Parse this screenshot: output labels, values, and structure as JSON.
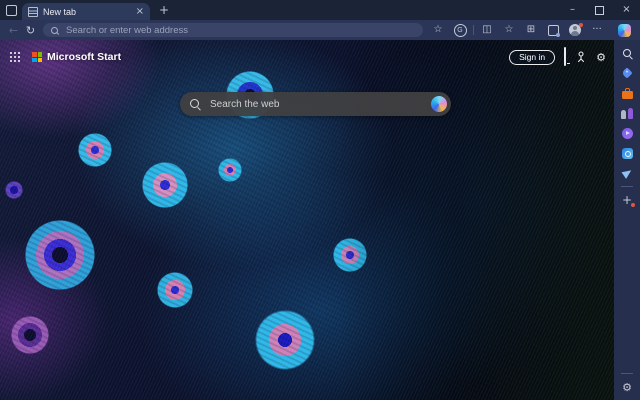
{
  "titlebar": {
    "tab_title": "New tab",
    "close_tab_glyph": "×",
    "new_tab_glyph": "+",
    "minimize_glyph": "–",
    "close_window_glyph": "×"
  },
  "toolbar": {
    "back_glyph": "←",
    "refresh_glyph": "↻",
    "address_placeholder": "Search or enter web address",
    "favorite_star_glyph": "☆",
    "extension_g_label": "G",
    "split_screen_glyph": "◫",
    "favorites_hub_glyph": "☆",
    "collections_glyph": "⊞",
    "more_glyph": "···"
  },
  "page": {
    "brand": "Microsoft Start",
    "sign_in": "Sign in",
    "search_placeholder": "Search the web",
    "settings_glyph": "⚙"
  },
  "sidebar": {
    "plus_glyph": "+",
    "settings_glyph": "⚙"
  },
  "colors": {
    "titlebar_bg": "#1b2337",
    "toolbar_bg": "#2b3557",
    "address_bar_bg": "#3a4468",
    "sidebar_bg": "#262f4e",
    "search_pill_bg": "#3f3f42",
    "microsoft_red": "#f25022",
    "microsoft_green": "#7fba00",
    "microsoft_blue": "#00a4ef",
    "microsoft_yellow": "#ffb900",
    "wallpaper_cyan": "#2fb7e8",
    "wallpaper_blue": "#2b2bd6",
    "wallpaper_pink": "#d87fb0",
    "wallpaper_purple": "#7a3f9e",
    "notification_red": "#e0543f"
  }
}
